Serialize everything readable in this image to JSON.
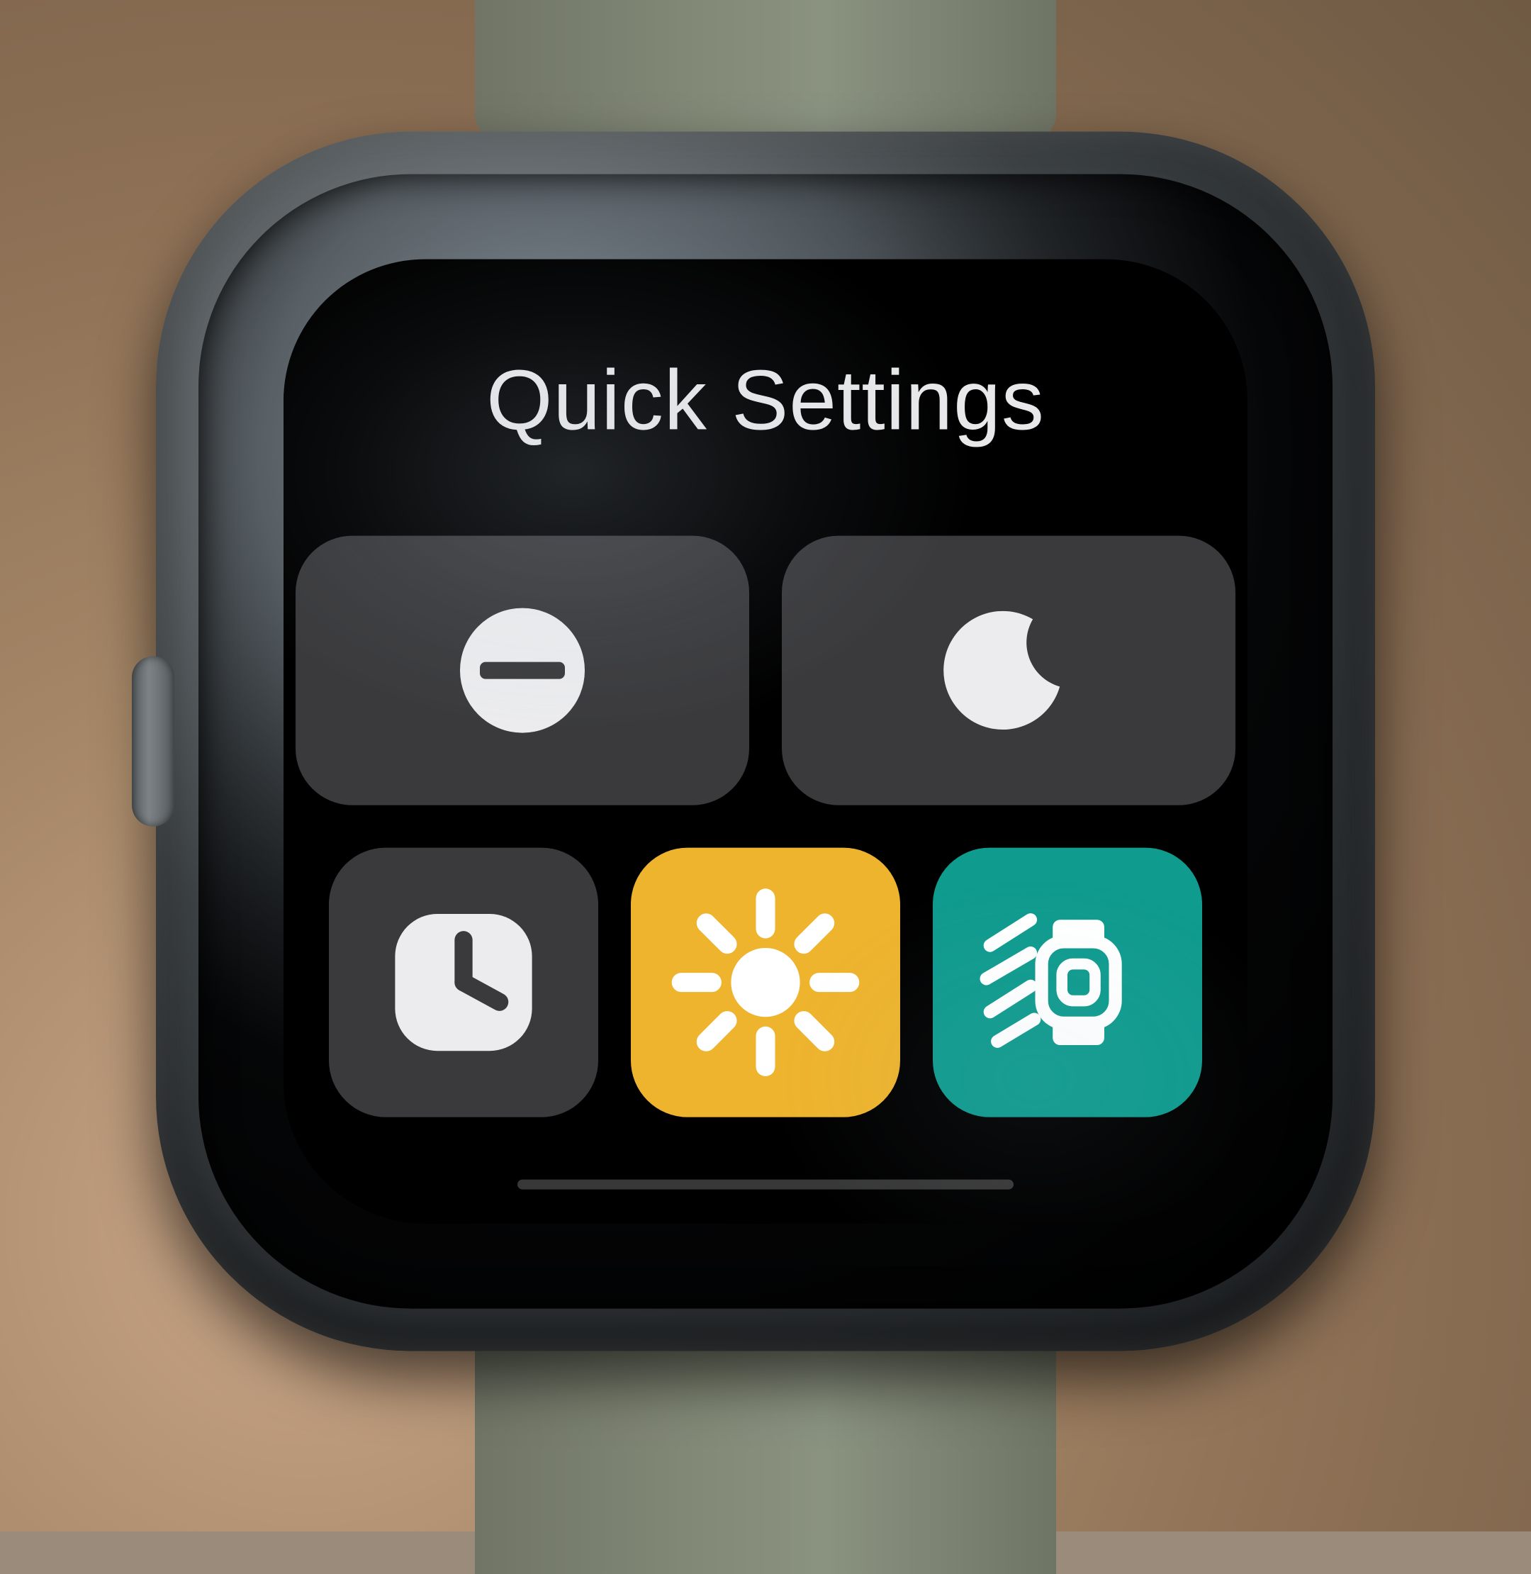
{
  "title": "Quick Settings",
  "colors": {
    "tile_grey": "#3a3a3c",
    "tile_amber": "#eeb42d",
    "tile_teal": "#0f9b8e",
    "icon_light": "#f0f0f2"
  },
  "tiles": {
    "dnd": {
      "icon": "do-not-disturb-icon",
      "active": false
    },
    "sleep": {
      "icon": "moon-icon",
      "active": false
    },
    "aod": {
      "icon": "clock-icon",
      "active": false
    },
    "brightness": {
      "icon": "sun-icon",
      "active": true
    },
    "wake": {
      "icon": "raise-to-wake-icon",
      "active": true
    }
  }
}
